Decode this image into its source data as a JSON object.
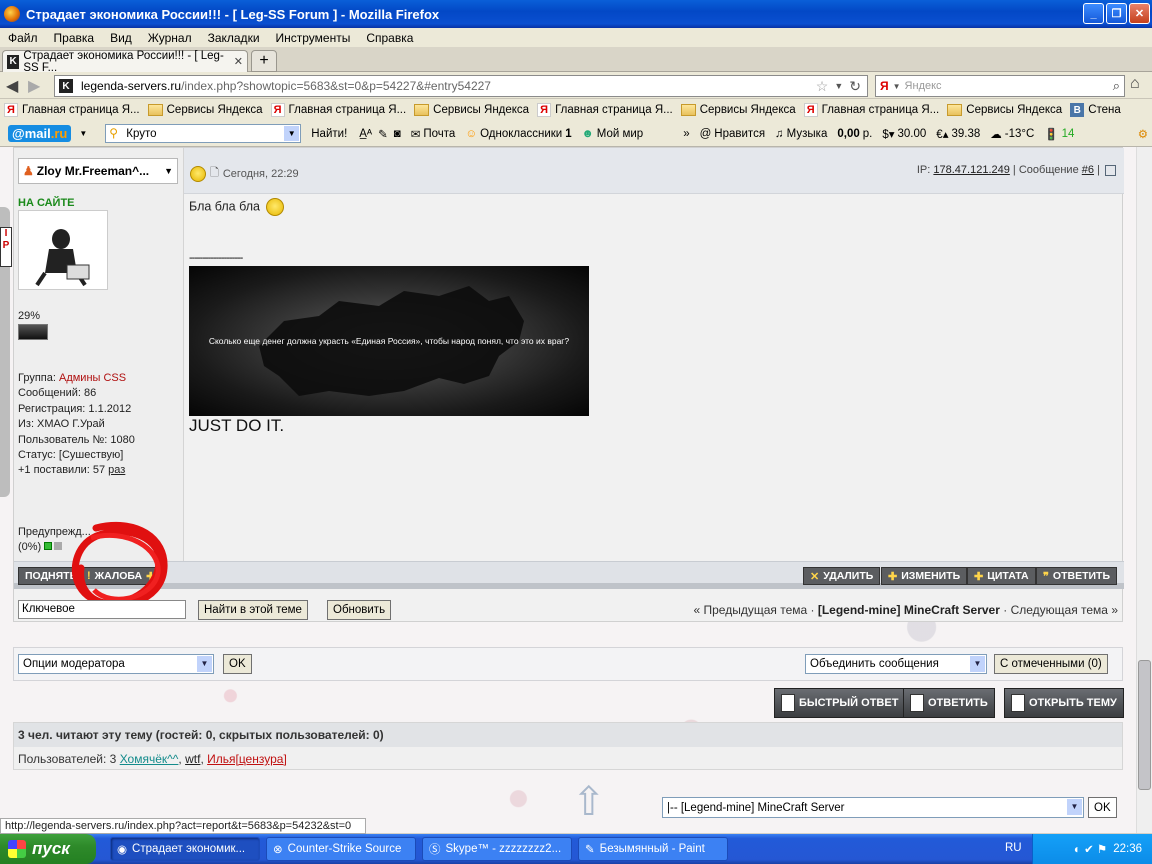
{
  "window": {
    "title": "Страдает экономика России!!! - [ Leg-SS Forum ] - Mozilla Firefox"
  },
  "menu": [
    "Файл",
    "Правка",
    "Вид",
    "Журнал",
    "Закладки",
    "Инструменты",
    "Справка"
  ],
  "tab": {
    "label": "Страдает экономика России!!! - [ Leg-SS F..."
  },
  "url": {
    "domain": "legenda-servers.ru",
    "path": "/index.php?showtopic=5683&st=0&p=54227&#entry54227"
  },
  "search": {
    "placeholder": "Яндекс"
  },
  "bookmarks": [
    {
      "label": "Главная страница Я...",
      "icon": "yandex-icon"
    },
    {
      "label": "Сервисы Яндекса",
      "icon": "folder-icon"
    },
    {
      "label": "Главная страница Я...",
      "icon": "yandex-icon"
    },
    {
      "label": "Сервисы Яндекса",
      "icon": "folder-icon"
    },
    {
      "label": "Главная страница Я...",
      "icon": "yandex-icon"
    },
    {
      "label": "Сервисы Яндекса",
      "icon": "folder-icon"
    },
    {
      "label": "Главная страница Я...",
      "icon": "yandex-icon"
    },
    {
      "label": "Сервисы Яндекса",
      "icon": "folder-icon"
    },
    {
      "label": "Стена",
      "icon": "vk-icon"
    }
  ],
  "mailbar": {
    "logo_at": "@",
    "logo": "mail",
    "logo_ru": ".ru",
    "search_value": "Круто",
    "find": "Найти!",
    "mail": "Почта",
    "ok": "Одноклассники",
    "ok_count": "1",
    "myworld": "Мой мир",
    "likes": "Нравится",
    "music": "Музыка",
    "balance": "0,00",
    "balance_unit": "р.",
    "usd": "30.00",
    "eur": "39.38",
    "weather": "-13°C",
    "traffic": "14"
  },
  "post": {
    "author": "Zloy Mr.Freeman^...",
    "online": "НА САЙТЕ",
    "date": "Сегодня, 22:29",
    "ip_label": "IP:",
    "ip": "178.47.121.249",
    "msg_label": "| Сообщение",
    "msg_num": "#6",
    "percent": "29%",
    "group_label": "Группа:",
    "group": "Админы CSS",
    "messages": "Сообщений: 86",
    "registered": "Регистрация: 1.1.2012",
    "from": "Из: ХМАО Г.Урай",
    "user_no": "Пользователь №: 1080",
    "status": "Статус: [Сушествую]",
    "plus_label": "+1 поставили: 57",
    "plus_link": "раз",
    "warn_label": "Предупрежд...",
    "warn_pct": "(0%)",
    "body": "Бла бла бла",
    "sig_dashes": "--------------------",
    "image_caption": "Сколько еще денег должна украсть «Единая Россия», чтобы народ понял, что это их враг?",
    "just_do_it": "JUST DO IT."
  },
  "post_buttons": {
    "up": "ПОДНЯТЬ",
    "report": "ЖАЛОБА",
    "delete": "УДАЛИТЬ",
    "edit": "ИЗМЕНИТЬ",
    "quote": "ЦИТАТА",
    "reply": "ОТВЕТИТЬ"
  },
  "topic_search": {
    "keyword": "Ключевое",
    "find_in_topic": "Найти в этой теме",
    "refresh": "Обновить",
    "prev": "« Предыдущая тема ·",
    "topic": "[Legend-mine] MineCraft Server",
    "next": "· Следующая тема »"
  },
  "moderation": {
    "options": "Опции модератора",
    "ok": "OK",
    "merge": "Объединить сообщения",
    "selected": "С отмеченными (0)"
  },
  "action_buttons": {
    "fast_reply": "БЫСТРЫЙ ОТВЕТ",
    "reply": "ОТВЕТИТЬ",
    "new_topic": "ОТКРЫТЬ ТЕМУ"
  },
  "readers": {
    "header": "3 чел. читают эту тему (гостей: 0, скрытых пользователей: 0)",
    "label": "Пользователей: 3",
    "u1": "Хомячёк^^",
    "u2": "wtf",
    "u3": "Илья[цензура]"
  },
  "jump": {
    "value": "|-- [Legend-mine] MineCraft Server",
    "ok": "OK"
  },
  "statusbar": {
    "url": "http://legenda-servers.ru/index.php?act=report&t=5683&p=54232&st=0"
  },
  "taskbar": {
    "start": "пуск",
    "tasks": [
      "Страдает экономик...",
      "Counter-Strike Source",
      "Skype™ - zzzzzzzz2...",
      "Безымянный - Paint"
    ],
    "lang": "RU",
    "time": "22:36"
  }
}
